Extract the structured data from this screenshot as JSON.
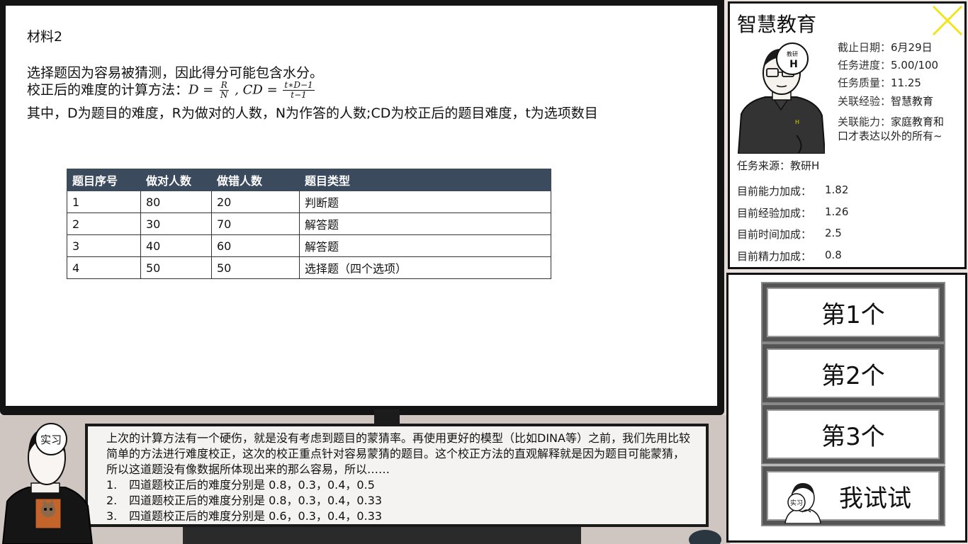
{
  "material": {
    "title": "材料2",
    "line1": "选择题因为容易被猜测，因此得分可能包含水分。",
    "line2_prefix": "校正后的难度的计算方法：",
    "formula": {
      "d_lhs": "D = ",
      "d_num": "R",
      "d_den": "N",
      "sep": " , ",
      "cd_lhs": "CD = ",
      "cd_num": "t∗D−1",
      "cd_den": "t−1"
    },
    "line3": "其中，D为题目的难度，R为做对的人数，N为作答的人数;CD为校正后的题目难度，t为选项数目"
  },
  "table": {
    "headers": [
      "题目序号",
      "做对人数",
      "做错人数",
      "题目类型"
    ],
    "rows": [
      [
        "1",
        "80",
        "20",
        "判断题"
      ],
      [
        "2",
        "30",
        "70",
        "解答题"
      ],
      [
        "3",
        "40",
        "60",
        "解答题"
      ],
      [
        "4",
        "50",
        "50",
        "选择题（四个选项）"
      ]
    ]
  },
  "task": {
    "name": "智慧教育",
    "info": [
      {
        "k": "截止日期：",
        "v": "6月29日"
      },
      {
        "k": "任务进度：",
        "v": "5.00/100"
      },
      {
        "k": "任务质量：",
        "v": "11.25"
      },
      {
        "k": "关联经验：",
        "v": "智慧教育"
      },
      {
        "k": "关联能力：",
        "v": "家庭教育和"
      },
      {
        "k": "",
        "v": "口才表达以外的所有~"
      }
    ],
    "source": "任务来源：教研H",
    "bonuses": [
      {
        "k": "目前能力加成：",
        "v": "1.82"
      },
      {
        "k": "目前经验加成：",
        "v": "1.26"
      },
      {
        "k": "目前时间加成：",
        "v": "2.5"
      },
      {
        "k": "目前精力加成：",
        "v": "0.8"
      }
    ],
    "teacher_badge": "教研H",
    "teacher_badge_line1": "教研",
    "teacher_badge_line2": "H"
  },
  "choices": [
    "第1个",
    "第2个",
    "第3个",
    "我试试"
  ],
  "dialog": {
    "intro": "上次的计算方法有一个硬伤，就是没有考虑到题目的蒙猜率。再使用更好的模型（比如DINA等）之前，我们先用比较简单的方法进行难度校正，这次的校正重点针对容易蒙猜的题目。这个校正方法的直观解释就是因为题目可能蒙猜，所以这道题没有像数据所体现出来的那么容易，所以……",
    "options": [
      {
        "n": "1.",
        "t": "四道题校正后的难度分别是 0.8，0.3，0.4，0.5"
      },
      {
        "n": "2.",
        "t": "四道题校正后的难度分别是 0.8，0.3，0.4，0.33"
      },
      {
        "n": "3.",
        "t": "四道题校正后的难度分别是 0.6，0.3，0.4，0.33"
      }
    ],
    "speaker_badge": "实习"
  },
  "icons": {
    "close": "close-x-icon",
    "accent": "#f2e31b",
    "table_header_bg": "#3b4a5c"
  }
}
